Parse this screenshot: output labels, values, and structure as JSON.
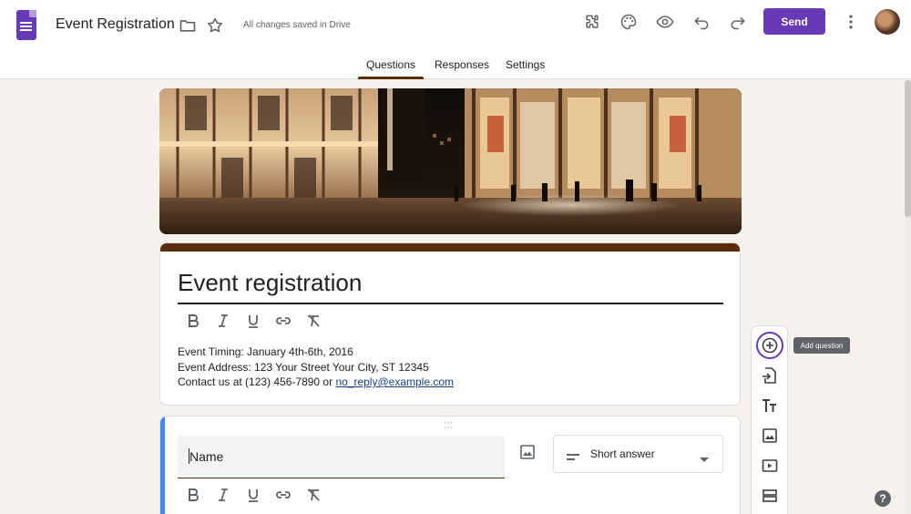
{
  "app": {
    "doc_title": "Event Registration",
    "saved_status": "All changes saved in Drive",
    "send_label": "Send",
    "accent_color": "#673ab7",
    "theme_color": "#5b2d0e"
  },
  "header_icons": [
    "forms-logo-icon",
    "folder-icon",
    "star-icon",
    "addon-puzzle-icon",
    "palette-icon",
    "preview-eye-icon",
    "undo-icon",
    "redo-icon",
    "more-vert-icon",
    "avatar"
  ],
  "tabs": [
    {
      "label": "Questions",
      "active": true
    },
    {
      "label": "Responses",
      "active": false
    },
    {
      "label": "Settings",
      "active": false
    }
  ],
  "form": {
    "title": "Event registration",
    "description_lines": [
      "Event Timing: January 4th-6th, 2016",
      "Event Address: 123 Your Street Your City, ST 12345",
      "Contact us at (123) 456-7890 or "
    ],
    "contact_email": "no_reply@example.com"
  },
  "question": {
    "title": "Name",
    "type": "Short answer"
  },
  "side_toolbar": {
    "tooltip": "Add question",
    "items": [
      "add-question-icon",
      "import-questions-icon",
      "add-title-icon",
      "add-image-icon",
      "add-video-icon",
      "add-section-icon"
    ]
  },
  "help_label": "?"
}
